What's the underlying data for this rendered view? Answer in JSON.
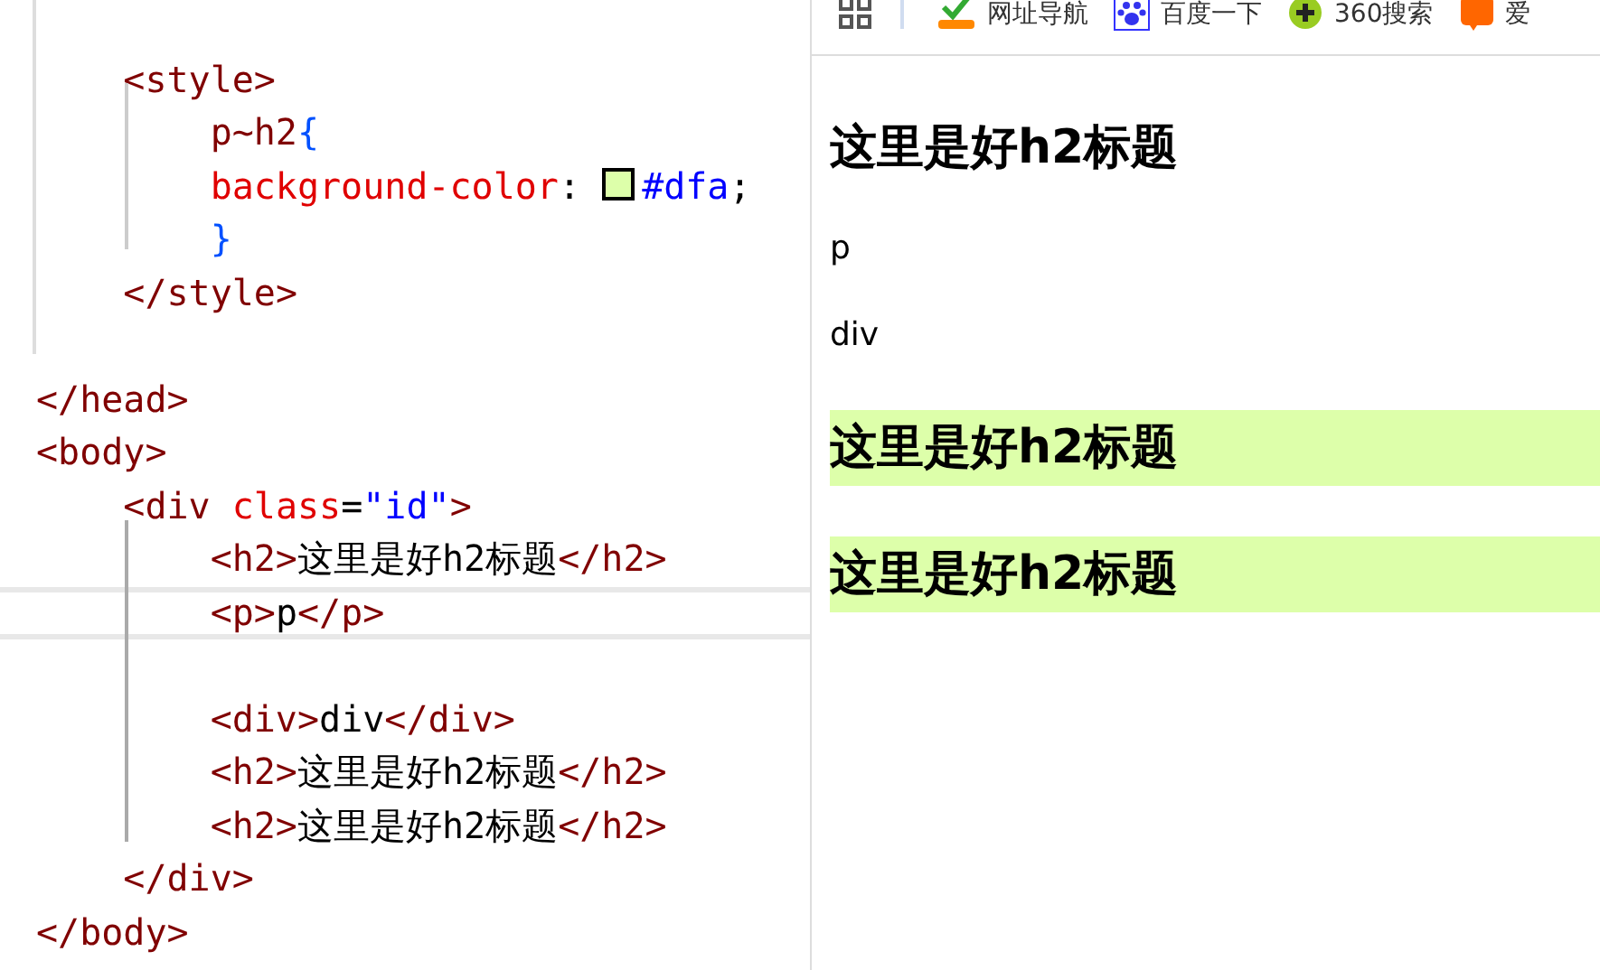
{
  "editor": {
    "lines": [
      {
        "current": false,
        "children": [
          {
            "current": false,
            "tokens": [
              {
                "kind": "tag",
                "text": "<style>"
              }
            ],
            "children": [
              {
                "current": false,
                "tokens": [
                  {
                    "kind": "tag",
                    "text": "p~h2"
                  },
                  {
                    "kind": "brace",
                    "text": "{"
                  }
                ]
              },
              {
                "current": false,
                "tokens": [
                  {
                    "kind": "attr",
                    "text": "background-color"
                  },
                  {
                    "kind": "text",
                    "text": ": "
                  },
                  {
                    "kind": "swatch",
                    "color": "#ddffaa"
                  },
                  {
                    "kind": "value",
                    "text": "#dfa"
                  },
                  {
                    "kind": "text",
                    "text": ";"
                  }
                ]
              },
              {
                "current": false,
                "tokens": [
                  {
                    "kind": "brace",
                    "text": "}"
                  }
                ]
              }
            ]
          },
          {
            "current": false,
            "tokens": [
              {
                "kind": "tag",
                "text": "</style>"
              }
            ]
          },
          {
            "current": false
          }
        ]
      },
      {
        "current": false,
        "tokens": [
          {
            "kind": "tag",
            "text": "</head>"
          }
        ]
      },
      {
        "current": false,
        "tokens": [
          {
            "kind": "tag",
            "text": "<body>"
          }
        ],
        "children": [
          {
            "current": false,
            "tokens": [
              {
                "kind": "tag",
                "text": "<div "
              },
              {
                "kind": "attr",
                "text": "class"
              },
              {
                "kind": "text",
                "text": "="
              },
              {
                "kind": "value",
                "text": "\"id\""
              },
              {
                "kind": "tag",
                "text": ">"
              }
            ],
            "children": [
              {
                "current": false,
                "tokens": [
                  {
                    "kind": "tag",
                    "text": "<h2>"
                  },
                  {
                    "kind": "text",
                    "text": "这里是好h2标题"
                  },
                  {
                    "kind": "tag",
                    "text": "</h2>"
                  }
                ]
              },
              {
                "current": true,
                "tokens": [
                  {
                    "kind": "tag",
                    "text": "<p>"
                  },
                  {
                    "kind": "text",
                    "text": "p"
                  },
                  {
                    "kind": "tag",
                    "text": "</p>"
                  }
                ]
              },
              {
                "current": false
              },
              {
                "current": false,
                "tokens": [
                  {
                    "kind": "tag",
                    "text": "<div>"
                  },
                  {
                    "kind": "text",
                    "text": "div"
                  },
                  {
                    "kind": "tag",
                    "text": "</div>"
                  }
                ]
              },
              {
                "current": false,
                "tokens": [
                  {
                    "kind": "tag",
                    "text": "<h2>"
                  },
                  {
                    "kind": "text",
                    "text": "这里是好h2标题"
                  },
                  {
                    "kind": "tag",
                    "text": "</h2>"
                  }
                ]
              },
              {
                "current": false,
                "tokens": [
                  {
                    "kind": "tag",
                    "text": "<h2>"
                  },
                  {
                    "kind": "text",
                    "text": "这里是好h2标题"
                  },
                  {
                    "kind": "tag",
                    "text": "</h2>"
                  }
                ]
              }
            ]
          },
          {
            "current": false,
            "tokens": [
              {
                "kind": "tag",
                "text": "</div>"
              }
            ]
          }
        ]
      },
      {
        "current": false,
        "tokens": [
          {
            "kind": "tag",
            "text": "</body>"
          }
        ]
      }
    ]
  },
  "browser": {
    "bookmarks": [
      {
        "kind": "hao",
        "label": "网址导航"
      },
      {
        "kind": "paw",
        "label": "百度一下"
      },
      {
        "kind": "plus",
        "label": "360搜索"
      },
      {
        "kind": "tao",
        "label": "爱"
      }
    ],
    "content": [
      {
        "kind": "h2",
        "text": "这里是好h2标题",
        "highlighted": false
      },
      {
        "kind": "p",
        "text": "p"
      },
      {
        "kind": "div",
        "text": "div"
      },
      {
        "kind": "h2",
        "text": "这里是好h2标题",
        "highlighted": true
      },
      {
        "kind": "h2",
        "text": "这里是好h2标题",
        "highlighted": true
      }
    ]
  }
}
